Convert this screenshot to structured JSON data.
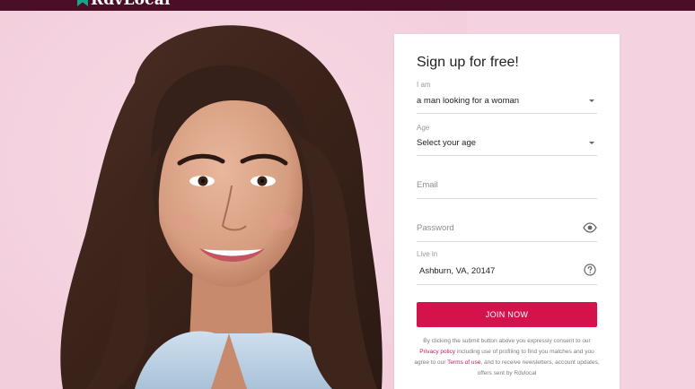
{
  "brand": {
    "name": "RdvLocal",
    "colors": {
      "header": "#4a0f27",
      "accent": "#d4134d",
      "background": "#f4d2df",
      "logo_icon": "#17a589"
    }
  },
  "hero": {
    "image_icon": "woman-portrait-photo"
  },
  "signup": {
    "title": "Sign up for free!",
    "iam": {
      "label": "I am",
      "value": "a man looking for a woman"
    },
    "age": {
      "label": "Age",
      "value": "Select your age"
    },
    "email": {
      "placeholder": "Email"
    },
    "password": {
      "placeholder": "Password",
      "icon": "eye-icon"
    },
    "location": {
      "label": "Live in",
      "value": "Ashburn, VA, 20147",
      "icon": "help-icon"
    },
    "join_label": "JOIN NOW",
    "consent": {
      "part1": "By clicking the submit button above you expressly consent to our ",
      "privacy_link": "Privacy policy",
      "part2": " including use of profiling to find you matches and you agree to our ",
      "terms_link": "Terms of use",
      "part3": ", and to receive newsletters, account updates, offers sent by Rdvlocal"
    }
  }
}
